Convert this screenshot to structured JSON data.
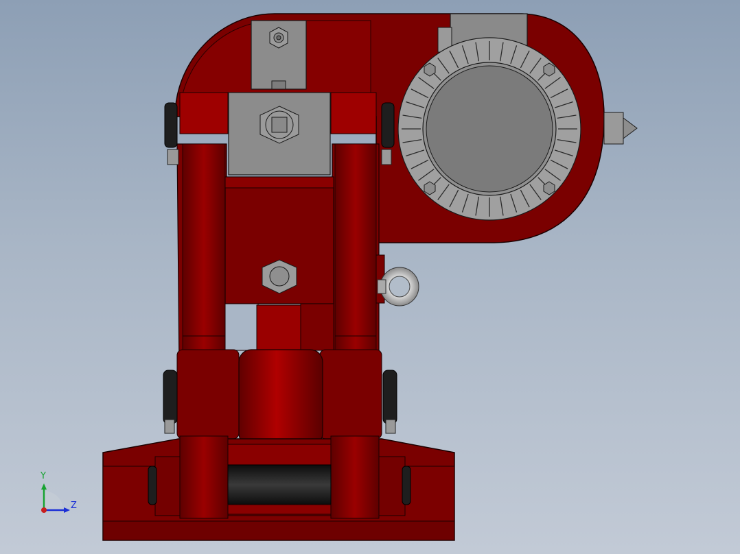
{
  "viewport": {
    "background_top": "#8d9fb5",
    "background_bottom": "#c2cad6"
  },
  "model": {
    "body_color": "#7a0000",
    "body_highlight": "#a80000",
    "outline_color": "#1a0000",
    "motor_color": "#8c8c8c",
    "motor_face_color": "#7b7b7b",
    "hardware_color": "#9a9a9a",
    "bumper_color": "#1e1e1e"
  },
  "triad": {
    "y_label": "Y",
    "z_label": "Z",
    "y_color": "#17a331",
    "z_color": "#1b2fd6",
    "origin_color": "#c81e1e"
  }
}
